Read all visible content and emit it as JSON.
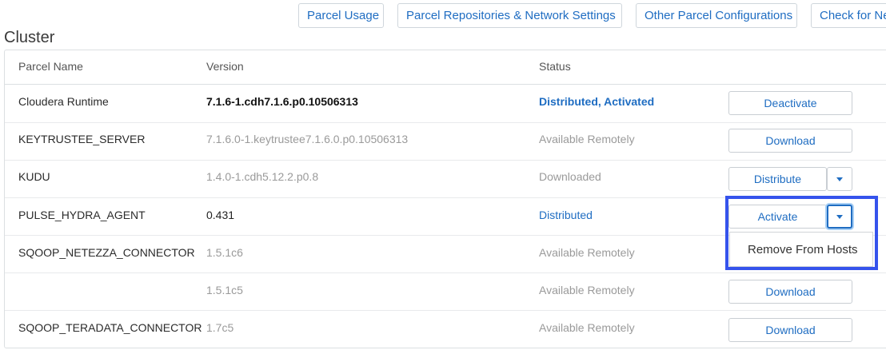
{
  "toolbar": {
    "parcel_usage": "Parcel Usage",
    "repos_network": "Parcel Repositories & Network Settings",
    "other_config": "Other Parcel Configurations",
    "check_new": "Check for Ne"
  },
  "cluster_title": "Cluster",
  "columns": {
    "name": "Parcel Name",
    "version": "Version",
    "status": "Status"
  },
  "rows": [
    {
      "name": "Cloudera Runtime",
      "version": "7.1.6-1.cdh7.1.6.p0.10506313",
      "status": "Distributed, Activated",
      "action": "Deactivate"
    },
    {
      "name": "KEYTRUSTEE_SERVER",
      "version": "7.1.6.0-1.keytrustee7.1.6.0.p0.10506313",
      "status": "Available Remotely",
      "action": "Download"
    },
    {
      "name": "KUDU",
      "version": "1.4.0-1.cdh5.12.2.p0.8",
      "status": "Downloaded",
      "action": "Distribute"
    },
    {
      "name": "PULSE_HYDRA_AGENT",
      "version": "0.431",
      "status": "Distributed",
      "action": "Activate"
    },
    {
      "name": "SQOOP_NETEZZA_CONNECTOR",
      "version": "1.5.1c6",
      "status": "Available Remotely",
      "action": ""
    },
    {
      "name": "",
      "version": "1.5.1c5",
      "status": "Available Remotely",
      "action": "Download"
    },
    {
      "name": "SQOOP_TERADATA_CONNECTOR",
      "version": "1.7c5",
      "status": "Available Remotely",
      "action": "Download"
    }
  ],
  "dropdown": {
    "remove_from_hosts": "Remove From Hosts"
  },
  "colors": {
    "accent": "#1f6dc2",
    "highlight": "#3553ec",
    "muted": "#9a9a9a"
  }
}
